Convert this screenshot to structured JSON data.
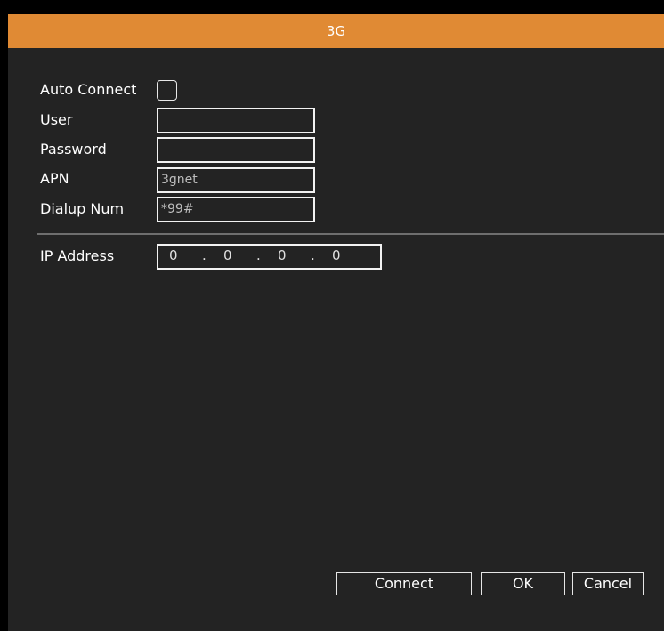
{
  "dialog": {
    "title": "3G"
  },
  "form": {
    "auto_connect_label": "Auto Connect",
    "auto_connect_checked": false,
    "user_label": "User",
    "user_value": "",
    "password_label": "Password",
    "password_value": "",
    "apn_label": "APN",
    "apn_value": "3gnet",
    "dialup_label": "Dialup Num",
    "dialup_value": "*99#",
    "ip_label": "IP Address",
    "ip_octets": [
      "0",
      "0",
      "0",
      "0"
    ],
    "ip_separator": "."
  },
  "buttons": {
    "connect": "Connect",
    "ok": "OK",
    "cancel": "Cancel"
  },
  "colors": {
    "titlebar": "#e08a34",
    "background": "#232323",
    "outer_background": "#000000"
  }
}
